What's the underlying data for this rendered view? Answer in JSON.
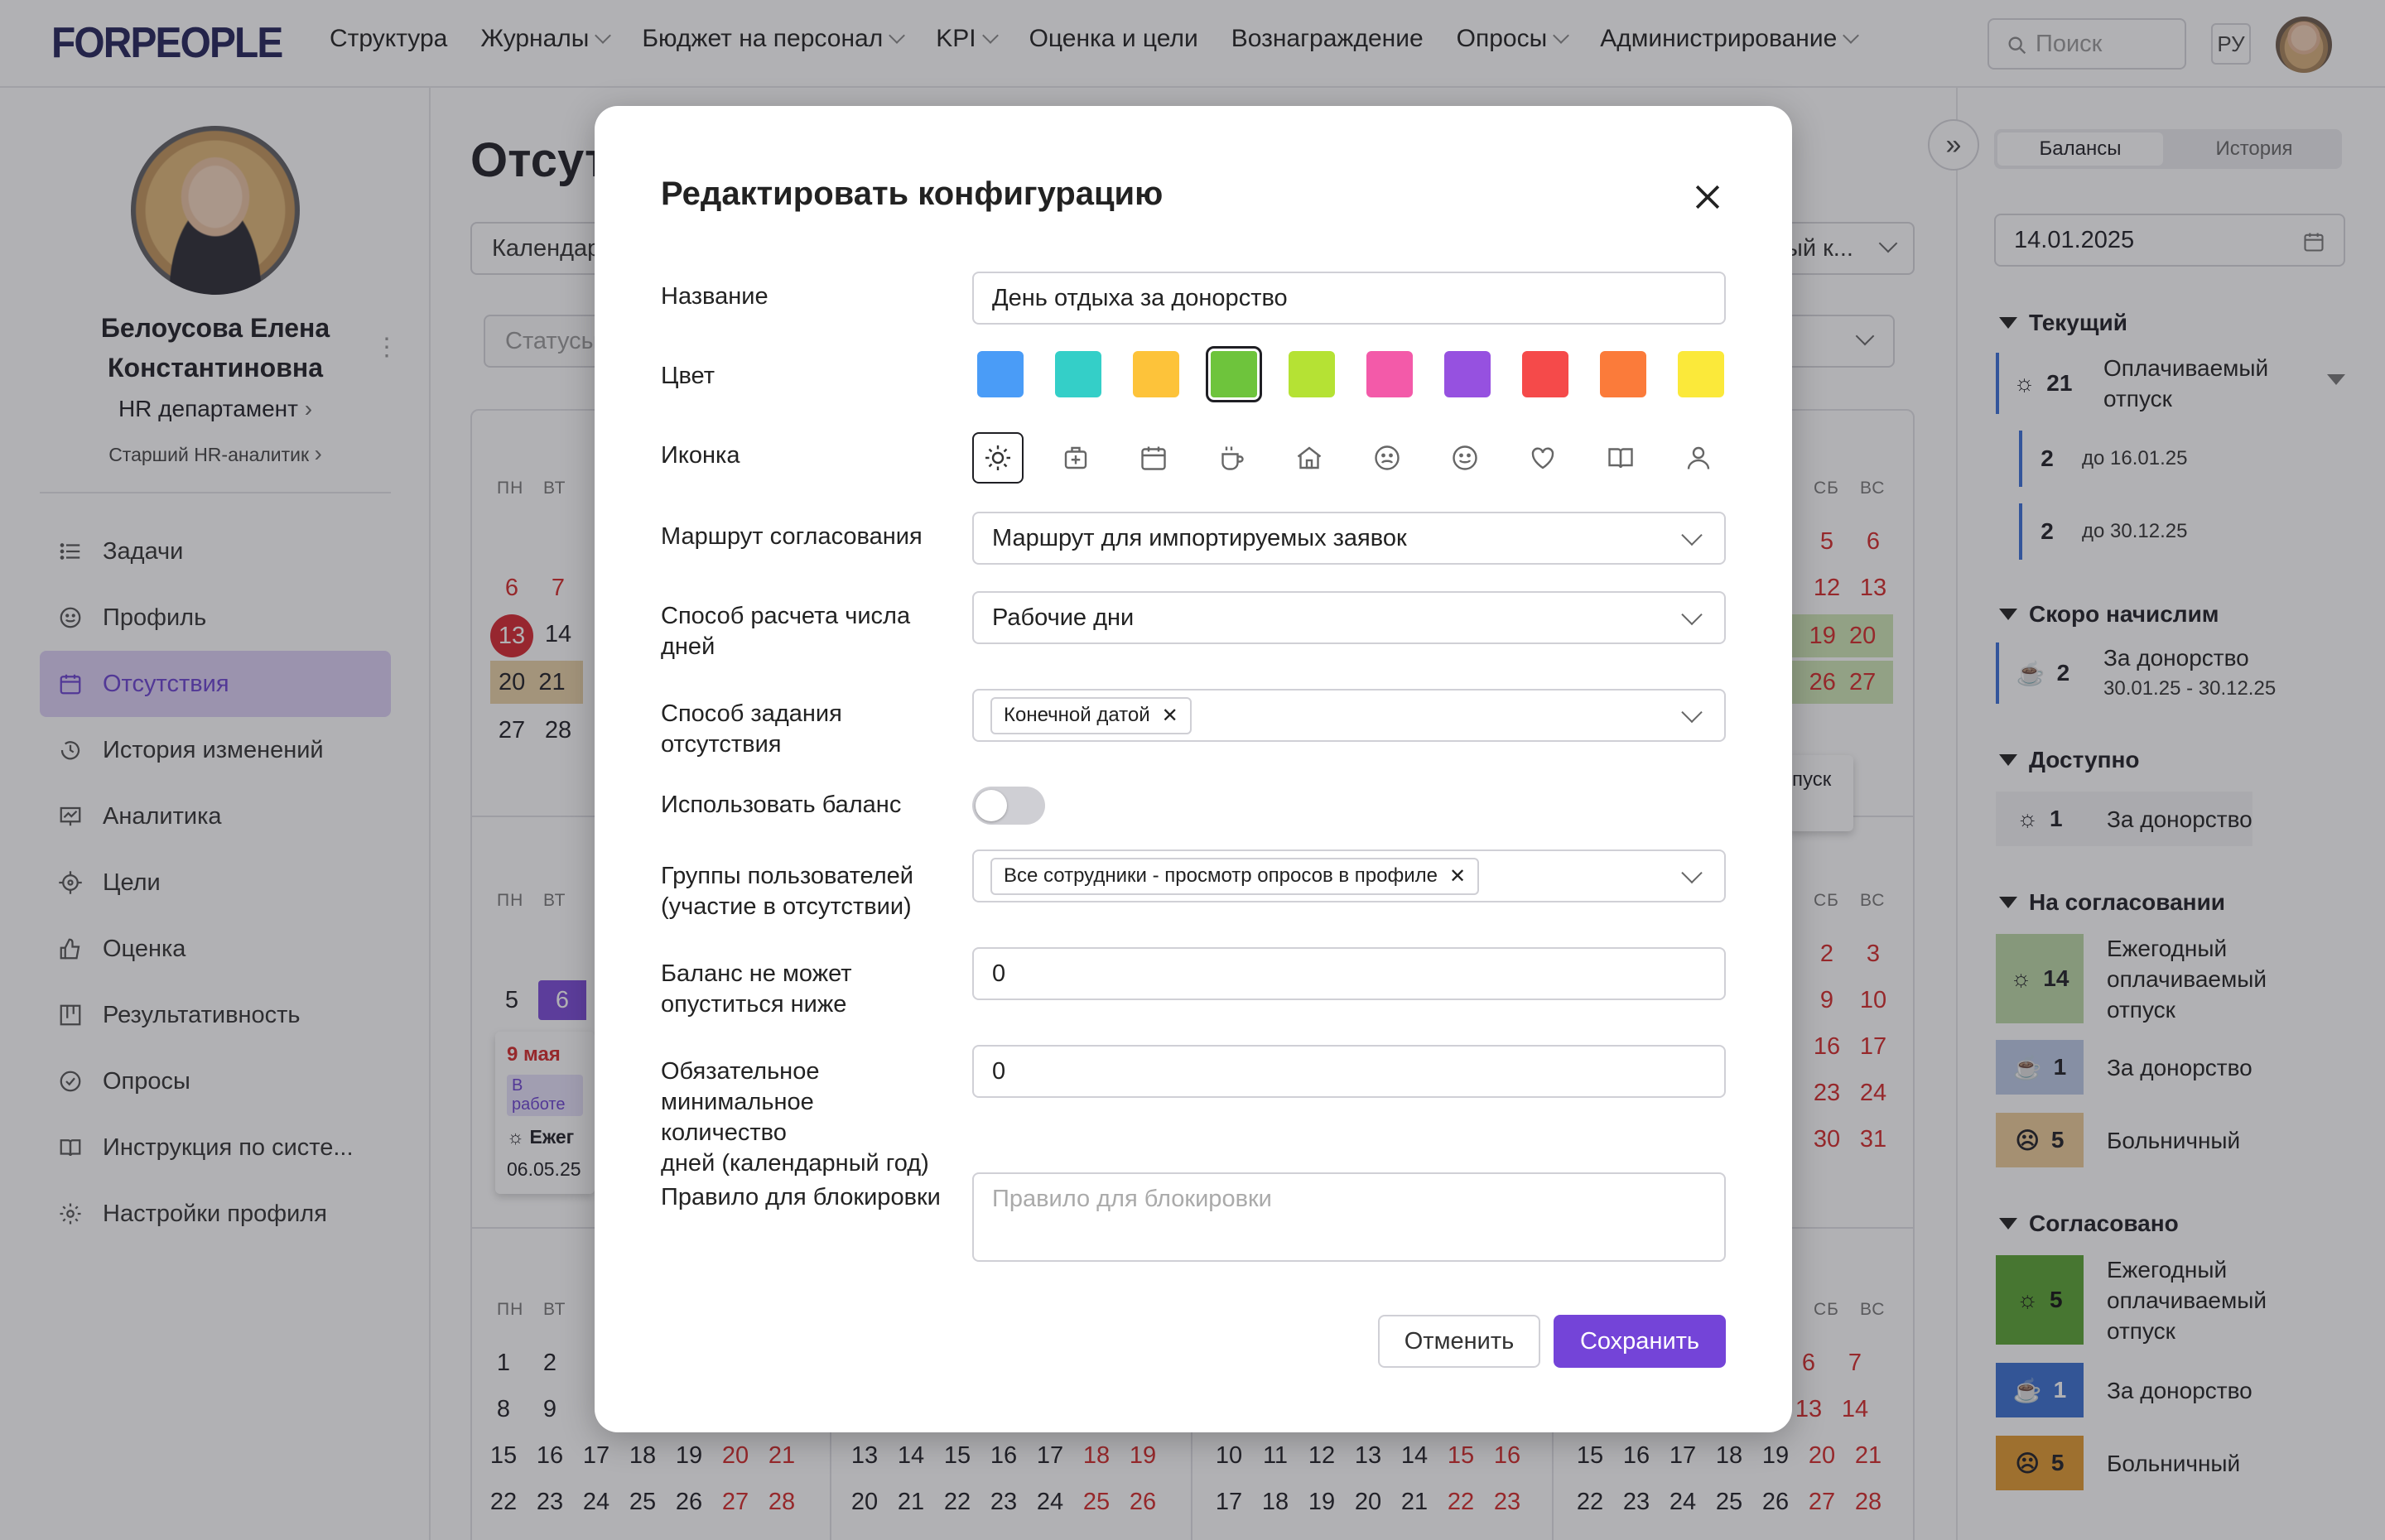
{
  "app": {
    "logo": "FORPEOPLE"
  },
  "nav": {
    "items": [
      {
        "label": "Структура",
        "dropdown": false
      },
      {
        "label": "Журналы",
        "dropdown": true
      },
      {
        "label": "Бюджет на персонал",
        "dropdown": true
      },
      {
        "label": "KPI",
        "dropdown": true
      },
      {
        "label": "Оценка и цели",
        "dropdown": false
      },
      {
        "label": "Вознаграждение",
        "dropdown": false
      },
      {
        "label": "Опросы",
        "dropdown": true
      },
      {
        "label": "Администрирование",
        "dropdown": true
      }
    ],
    "search_placeholder": "Поиск",
    "lang": "РУ"
  },
  "profile": {
    "name_line1": "Белоусова Елена",
    "name_line2": "Константиновна",
    "department": "HR департамент",
    "position": "Старший HR-аналитик"
  },
  "menu": {
    "items": [
      {
        "label": "Задачи",
        "icon": "list-icon"
      },
      {
        "label": "Профиль",
        "icon": "smile-icon"
      },
      {
        "label": "Отсутствия",
        "icon": "calendar-icon",
        "active": true
      },
      {
        "label": "История изменений",
        "icon": "history-icon"
      },
      {
        "label": "Аналитика",
        "icon": "analytics-icon"
      },
      {
        "label": "Цели",
        "icon": "target-icon"
      },
      {
        "label": "Оценка",
        "icon": "thumbs-up-icon"
      },
      {
        "label": "Результативность",
        "icon": "kanban-icon"
      },
      {
        "label": "Опросы",
        "icon": "check-circle-icon"
      },
      {
        "label": "Инструкция по систе...",
        "icon": "book-icon"
      },
      {
        "label": "Настройки профиля",
        "icon": "gear-icon"
      }
    ]
  },
  "main": {
    "title": "Отсут",
    "calendar_select": "Календар",
    "status_select": "Статусы",
    "right_select": "ый к...",
    "dow": [
      "ПН",
      "ВТ",
      "СБ",
      "ВС"
    ],
    "popup_text": "пуск",
    "event": {
      "date": "9 мая",
      "status": "В работе",
      "type": "Ежег",
      "from": "06.05.25"
    }
  },
  "right_panel": {
    "tabs": [
      "Балансы",
      "История"
    ],
    "date": "14.01.2025",
    "sections": {
      "current": "Текущий",
      "soon": "Скоро начислим",
      "available": "Доступно",
      "approval": "На согласовании",
      "approved": "Согласовано"
    },
    "current_main": {
      "count": "21",
      "label_line1": "Оплачиваемый",
      "label_line2": "отпуск"
    },
    "current_sub": [
      {
        "count": "2",
        "label": "до 16.01.25"
      },
      {
        "count": "2",
        "label": "до 30.12.25"
      }
    ],
    "soon": {
      "count": "2",
      "label": "За донорство",
      "range": "30.01.25 - 30.12.25"
    },
    "available": {
      "count": "1",
      "label": "За донорство"
    },
    "approval": [
      {
        "count": "14",
        "l1": "Ежегодный",
        "l2": "оплачиваемый",
        "l3": "отпуск"
      },
      {
        "count": "1",
        "l1": "За донорство"
      },
      {
        "count": "5",
        "l1": "Больничный"
      }
    ],
    "approved": [
      {
        "count": "5",
        "l1": "Ежегодный",
        "l2": "оплачиваемый",
        "l3": "отпуск"
      },
      {
        "count": "1",
        "l1": "За донорство"
      },
      {
        "count": "5",
        "l1": "Больничный"
      }
    ]
  },
  "modal": {
    "title": "Редактировать конфигурацию",
    "labels": {
      "name": "Название",
      "color": "Цвет",
      "icon": "Иконка",
      "route": "Маршрут согласования",
      "calc_l1": "Способ расчета числа",
      "calc_l2": "дней",
      "mode_l1": "Способ задания",
      "mode_l2": "отсутствия",
      "use_balance": "Использовать баланс",
      "groups_l1": "Группы пользователей",
      "groups_l2": "(участие в отсутствии)",
      "min_l1": "Баланс не может",
      "min_l2": "опуститься ниже",
      "req_l1": "Обязательное",
      "req_l2": "минимальное количество",
      "req_l3": "дней (календарный год)",
      "block": "Правило для блокировки"
    },
    "values": {
      "name": "День отдыха за донорство",
      "route": "Маршрут для импортируемых заявок",
      "calc": "Рабочие дни",
      "mode_chip": "Конечной датой",
      "use_balance": false,
      "groups_chip": "Все сотрудники - просмотр опросов в профиле",
      "min_balance": "0",
      "required_days": "0",
      "block_placeholder": "Правило для блокировки"
    },
    "colors": [
      "#4a9cf7",
      "#34cfc8",
      "#fdc33a",
      "#6ec43c",
      "#b5e234",
      "#f35aa9",
      "#9651e0",
      "#f54a4a",
      "#fb7b3a",
      "#fbe93a"
    ],
    "selected_color": "#6ec43c",
    "icons": [
      "sun-icon",
      "medkit-icon",
      "calendar-icon",
      "coffee-icon",
      "home-icon",
      "sad-face-icon",
      "smile-face-icon",
      "heart-icon",
      "book-icon",
      "user-icon"
    ],
    "selected_icon": "sun-icon",
    "buttons": {
      "cancel": "Отменить",
      "save": "Сохранить"
    }
  }
}
